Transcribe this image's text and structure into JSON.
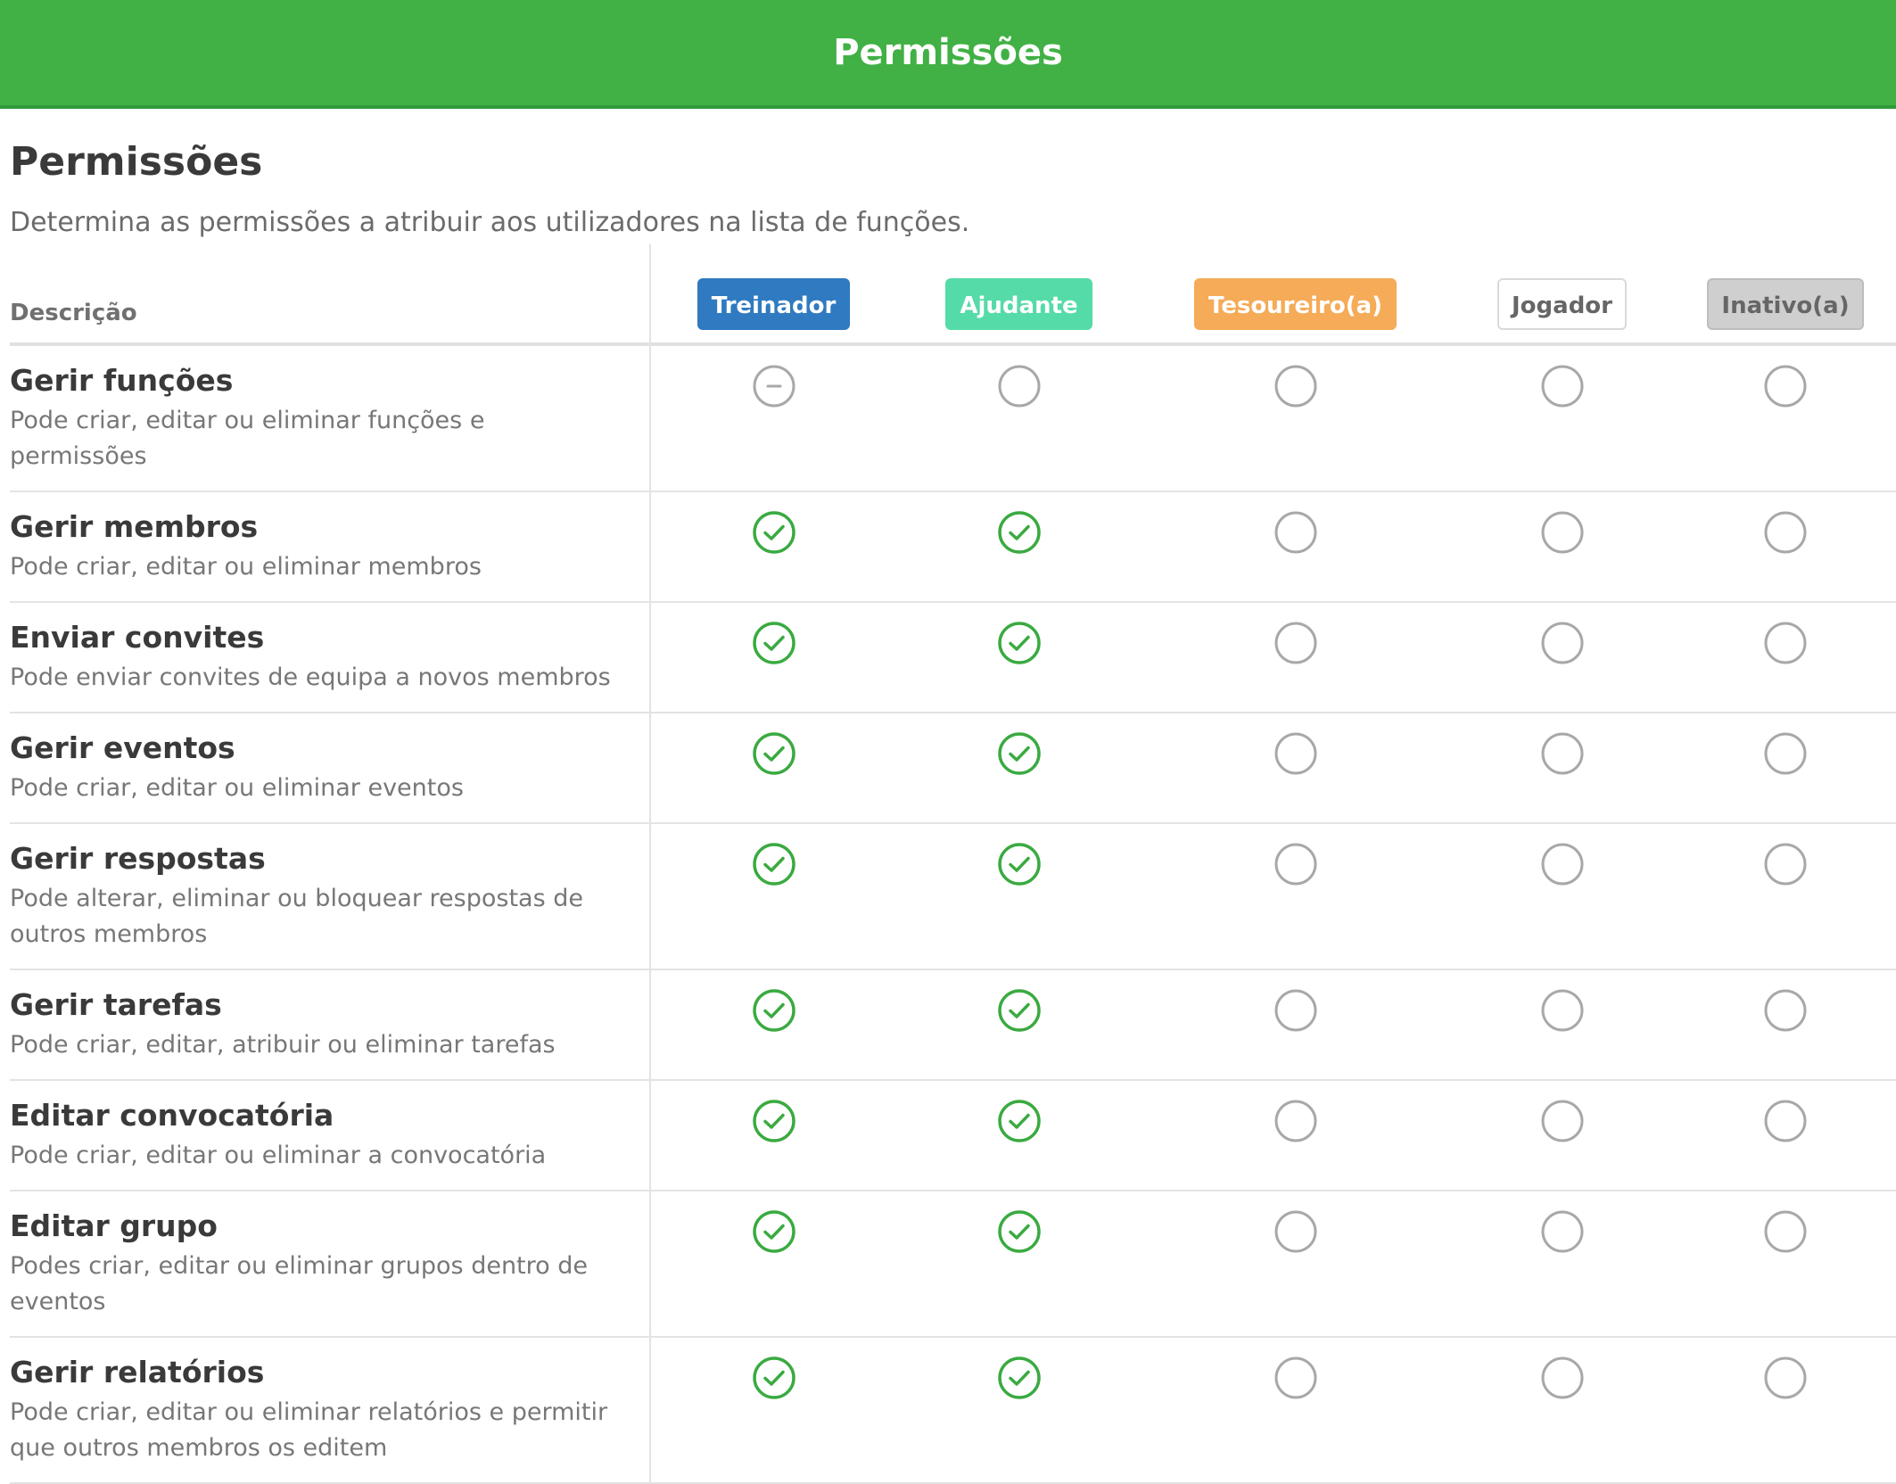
{
  "app_title": "Permissões",
  "page_heading": "Permissões",
  "page_subtitle": "Determina as permissões a atribuir aos utilizadores na lista de funções.",
  "description_header": "Descrição",
  "roles": [
    {
      "label": "Treinador",
      "bg": "#2f7ac0",
      "fg": "#ffffff",
      "border": "#2f7ac0"
    },
    {
      "label": "Ajudante",
      "bg": "#55dba8",
      "fg": "#ffffff",
      "border": "#55dba8"
    },
    {
      "label": "Tesoureiro(a)",
      "bg": "#f5ab57",
      "fg": "#ffffff",
      "border": "#f5ab57"
    },
    {
      "label": "Jogador",
      "bg": "#ffffff",
      "fg": "#666666",
      "border": "#d9d9d9"
    },
    {
      "label": "Inativo(a)",
      "bg": "#cfcfcf",
      "fg": "#666666",
      "border": "#bdbdbd"
    }
  ],
  "permissions": [
    {
      "title": "Gerir funções",
      "description": "Pode criar, editar ou eliminar funções e permissões",
      "states": [
        "locked",
        "off",
        "off",
        "off",
        "off"
      ]
    },
    {
      "title": "Gerir membros",
      "description": "Pode criar, editar ou eliminar membros",
      "states": [
        "on",
        "on",
        "off",
        "off",
        "off"
      ]
    },
    {
      "title": "Enviar convites",
      "description": "Pode enviar convites de equipa a novos membros",
      "states": [
        "on",
        "on",
        "off",
        "off",
        "off"
      ]
    },
    {
      "title": "Gerir eventos",
      "description": "Pode criar, editar ou eliminar eventos",
      "states": [
        "on",
        "on",
        "off",
        "off",
        "off"
      ]
    },
    {
      "title": "Gerir respostas",
      "description": "Pode alterar, eliminar ou bloquear respostas de outros membros",
      "states": [
        "on",
        "on",
        "off",
        "off",
        "off"
      ]
    },
    {
      "title": "Gerir tarefas",
      "description": "Pode criar, editar, atribuir ou eliminar tarefas",
      "states": [
        "on",
        "on",
        "off",
        "off",
        "off"
      ]
    },
    {
      "title": "Editar convocatória",
      "description": "Pode criar, editar ou eliminar a convocatória",
      "states": [
        "on",
        "on",
        "off",
        "off",
        "off"
      ]
    },
    {
      "title": "Editar grupo",
      "description": "Podes criar, editar ou eliminar grupos dentro de eventos",
      "states": [
        "on",
        "on",
        "off",
        "off",
        "off"
      ]
    },
    {
      "title": "Gerir relatórios",
      "description": "Pode criar, editar ou eliminar relatórios e permitir que outros membros os editem",
      "states": [
        "on",
        "on",
        "off",
        "off",
        "off"
      ]
    }
  ],
  "colors": {
    "header_green": "#41b045",
    "check_green": "#3aaa40",
    "empty_circle": "#a8a8a8",
    "locked_circle": "#a8a8a8"
  }
}
